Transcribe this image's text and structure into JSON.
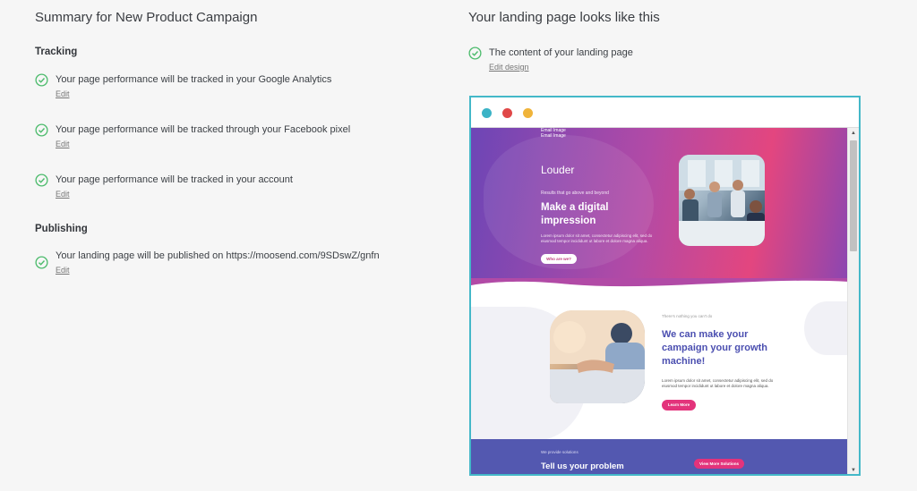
{
  "summary": {
    "title": "Summary for New Product Campaign",
    "tracking": {
      "heading": "Tracking",
      "items": [
        {
          "text": "Your page performance will be tracked in your Google Analytics",
          "link": "Edit"
        },
        {
          "text": "Your page performance will be tracked through your Facebook pixel",
          "link": "Edit"
        },
        {
          "text": "Your page performance will be tracked in your account",
          "link": "Edit"
        }
      ]
    },
    "publishing": {
      "heading": "Publishing",
      "items": [
        {
          "text": "Your landing page will be published on https://moosend.com/9SDswZ/gnfn",
          "link": "Edit"
        }
      ]
    }
  },
  "preview": {
    "title": "Your landing page looks like this",
    "content_item": {
      "text": "The content of your landing page",
      "link": "Edit design"
    },
    "window_dots": [
      "#3bb3c6",
      "#e04848",
      "#f0b43a"
    ],
    "landing": {
      "hero": {
        "alt_text": "Email Image\nEmail Image",
        "logo": "Louder",
        "small": "Results that go above and beyond",
        "headline": "Make a digital impression",
        "lorem": "Lorem ipsum dolor sit amet, consectetur adipiscing elit, sed do eiusmod tempor incididunt ut labore et dolore magna aliqua.",
        "button": "Who are we?"
      },
      "section2": {
        "small": "There's nothing you can't do",
        "headline": "We can make your campaign your growth machine!",
        "lorem": "Lorem ipsum dolor sit amet, consectetur adipiscing elit, sed do eiusmod tempor incididunt ut labore et dolore magna aliqua.",
        "button": "Learn More"
      },
      "section3": {
        "small": "We provide solutions",
        "headline": "Tell us your problem",
        "button": "View More Solutions"
      }
    }
  },
  "colors": {
    "check": "#4cbb6c",
    "browser_border": "#44b8c8",
    "accent_pink": "#e3337b",
    "accent_purple": "#5358b0"
  }
}
